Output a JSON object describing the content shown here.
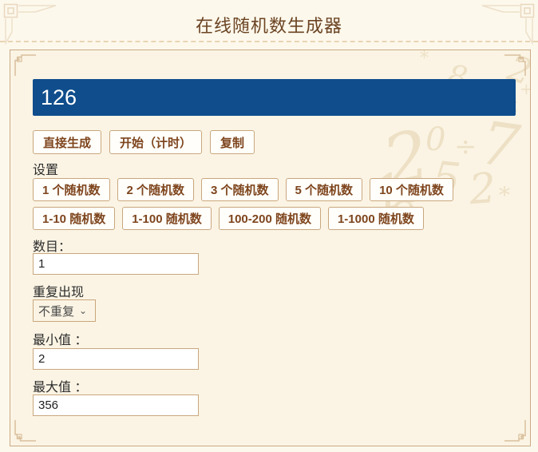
{
  "header": {
    "title": "在线随机数生成器"
  },
  "result": {
    "value": "126"
  },
  "actions": {
    "generate": "直接生成",
    "start_timed": "开始（计时）",
    "copy": "复制"
  },
  "settings": {
    "label": "设置",
    "count_presets": [
      "1 个随机数",
      "2 个随机数",
      "3 个随机数",
      "5 个随机数",
      "10 个随机数"
    ],
    "range_presets": [
      "1-10 随机数",
      "1-100 随机数",
      "100-200 随机数",
      "1-1000 随机数"
    ]
  },
  "form": {
    "count_label": "数目：",
    "count_value": "1",
    "repeat_label": "重复出现",
    "repeat_value": "不重复",
    "min_label": "最小值 ：",
    "min_value": "2",
    "max_label": "最大值 ：",
    "max_value": "356"
  },
  "colors": {
    "accent_blue": "#0F4D8C",
    "tan_border": "#C9A77E",
    "button_text_brown": "#7E451E",
    "title_brown": "#6B4423",
    "panel_cream": "#FBF4E4"
  },
  "watermark": {
    "glyphs": [
      "*",
      "8",
      "2",
      "0",
      "2",
      "÷",
      "7",
      "5",
      "1",
      "8",
      "×",
      "*",
      "2",
      "+"
    ]
  }
}
